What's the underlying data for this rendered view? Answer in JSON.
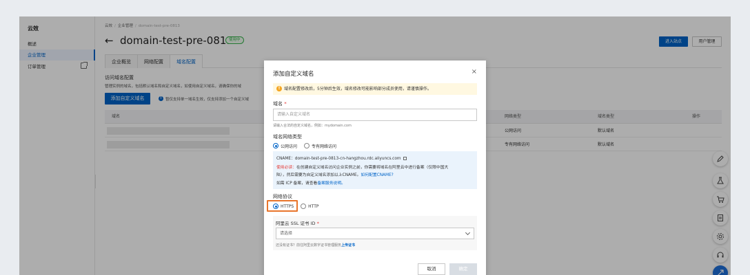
{
  "sidebar": {
    "title": "云效",
    "items": [
      {
        "label": "概述"
      },
      {
        "label": "企业管理"
      },
      {
        "label": "订单管理"
      }
    ]
  },
  "breadcrumb": {
    "items": [
      "云效",
      "企业管理",
      "domain-test-pre-0813"
    ]
  },
  "header": {
    "title": "domain-test-pre-0813",
    "status": "使用中",
    "enter_site": "进入站点",
    "user_manage": "用户管理"
  },
  "tabs": [
    {
      "label": "企业概览"
    },
    {
      "label": "网络配置"
    },
    {
      "label": "域名配置"
    }
  ],
  "domain_section": {
    "title": "访问域名配置",
    "desc": "管理实例的域名，包括默认域名和自定义域名，如使用自定义域名，请确保你的域",
    "add_button": "添加自定义域名",
    "info_text": "暂仅支持单一域名生效，仅支持添加一个自定义域"
  },
  "table": {
    "headers": [
      "域名",
      "网络类型",
      "域名类型",
      "操作"
    ],
    "rows": [
      {
        "network": "公网访问",
        "type": "默认域名"
      },
      {
        "network": "专有网络访问",
        "type": "默认域名"
      }
    ]
  },
  "dialog": {
    "title": "添加自定义域名",
    "close": "×",
    "warning": "域名配置修改后，5分钟后生效，域名修改可能影响部分成员使用，请谨慎操作。",
    "domain_label": "域名",
    "required_mark": "*",
    "domain_placeholder": "请输入自定义域名",
    "domain_hint": "请输入合法的自定义域名，例如：mydomain.com",
    "network_label": "域名网络类型",
    "network_options": [
      "公网访问",
      "专有网络访问"
    ],
    "cname_line": "CNAME：domain-test-pre-0813-cn-hangzhou.rdc.aliyuncs.com",
    "must_read": "使用必读：",
    "line2": "在创建自定义域名访问企业实例之前，你需要将域名在阿里云中进行备案（仅限中国大",
    "line3a": "陆），然后需要为自定义域名添加以上CNAME。",
    "line3b": "如何配置CNAME?",
    "line4a": "如需 ICP 备案，请查看",
    "line4b": "备案服务说明。",
    "protocol_label": "网络协议",
    "protocol_options": [
      "HTTPS",
      "HTTP"
    ],
    "cert_label": "阿里云 SSL 证书 ID",
    "cert_placeholder": "请选择",
    "cert_hint_a": "还没有证书？前往阿里云数字证书管理服务",
    "cert_hint_b": "上传证书",
    "cancel": "取消",
    "ok": "确定"
  },
  "colors": {
    "primary": "#0064c8",
    "status_green": "#35b34a",
    "highlight_orange": "#e8742a",
    "warning_bg": "#fff8e1",
    "info_bg": "#eaf3fc"
  }
}
